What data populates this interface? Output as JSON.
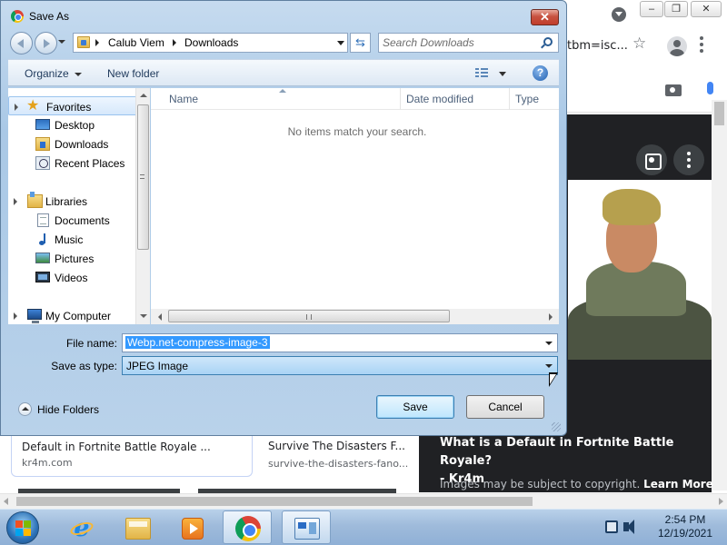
{
  "browser": {
    "url_fragment": "tbm=isc...",
    "caption": {
      "title": "What is a Default in Fortnite Battle Royale?",
      "source": "- Kr4m"
    },
    "copyright_text": "Images may be subject to copyright.",
    "learn_more": "Learn More",
    "results": [
      {
        "title": "Default in Fortnite Battle Royale ...",
        "source": "kr4m.com"
      },
      {
        "title": "Survive The Disasters F...",
        "source": "survive-the-disasters-fano..."
      }
    ]
  },
  "dialog": {
    "title": "Save As",
    "close_glyph": "✕",
    "breadcrumb": [
      "Calub Viem",
      "Downloads"
    ],
    "search_placeholder": "Search Downloads",
    "commands": {
      "organize": "Organize",
      "new_folder": "New folder"
    },
    "help_glyph": "?",
    "nav": {
      "favorites": "Favorites",
      "desktop": "Desktop",
      "downloads": "Downloads",
      "recent_places": "Recent Places",
      "libraries": "Libraries",
      "documents": "Documents",
      "music": "Music",
      "pictures": "Pictures",
      "videos": "Videos",
      "my_computer": "My Computer"
    },
    "columns": {
      "name": "Name",
      "date_modified": "Date modified",
      "type": "Type"
    },
    "empty_message": "No items match your search.",
    "filename_label": "File name:",
    "filename_value": "Webp.net-compress-image-3",
    "filetype_label": "Save as type:",
    "filetype_value": "JPEG Image",
    "hide_folders": "Hide Folders",
    "save_label": "Save",
    "cancel_label": "Cancel"
  },
  "taskbar": {
    "time": "2:54 PM",
    "date": "12/19/2021"
  },
  "colors": {
    "selection": "#3399ff",
    "dialog_chrome": "#b9d2ea",
    "taskbar": "#9fbbdb",
    "dark_panel": "#202124"
  }
}
